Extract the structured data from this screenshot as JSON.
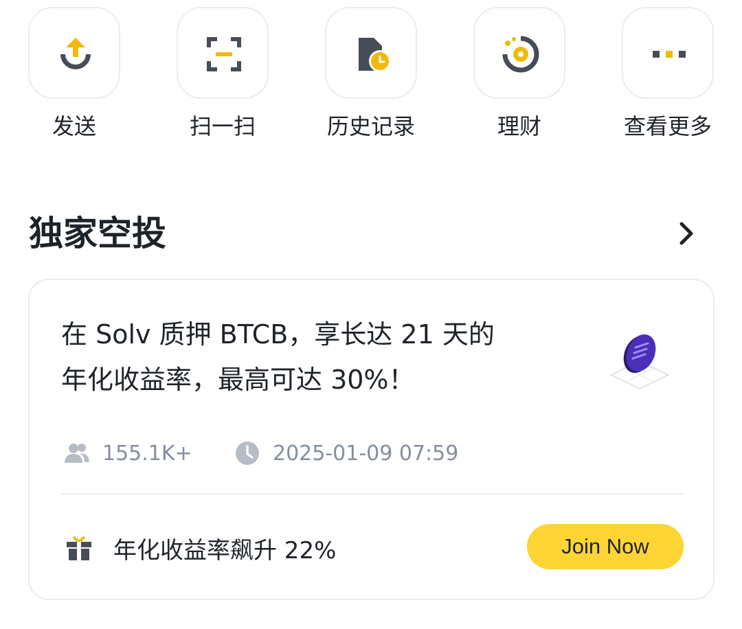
{
  "quick_actions": [
    {
      "label": "发送",
      "icon": "send-icon"
    },
    {
      "label": "扫一扫",
      "icon": "scan-icon"
    },
    {
      "label": "历史记录",
      "icon": "history-icon"
    },
    {
      "label": "理财",
      "icon": "earn-icon"
    },
    {
      "label": "查看更多",
      "icon": "more-icon"
    }
  ],
  "section": {
    "title": "独家空投",
    "arrow_icon": "chevron-right-icon"
  },
  "card": {
    "title_line1": "在 Solv 质押 BTCB，享长达 21 天的",
    "title_line2": "年化收益率，最高可达 30%！",
    "logo_icon": "solv-token-icon",
    "participants": "155.1K+",
    "participants_icon": "users-icon",
    "datetime": "2025-01-09 07:59",
    "datetime_icon": "clock-icon",
    "reward_text": "年化收益率飙升 22%",
    "reward_icon": "gift-icon",
    "join_label": "Join Now"
  },
  "colors": {
    "accent": "#fcd535",
    "icon_yellow": "#f0b90b",
    "icon_dark": "#474d57",
    "text": "#1e2329",
    "muted": "#848e9c",
    "border": "#eaecef"
  }
}
